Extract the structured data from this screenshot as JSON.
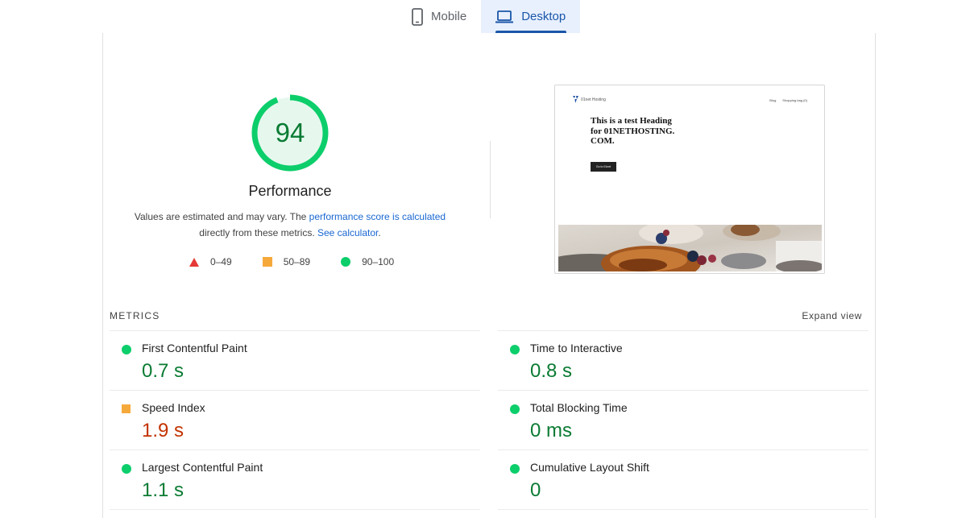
{
  "tabs": [
    {
      "label": "Mobile",
      "icon": "phone-icon",
      "active": false
    },
    {
      "label": "Desktop",
      "icon": "laptop-icon",
      "active": true
    }
  ],
  "performance": {
    "score": "94",
    "score_value": 94,
    "title": "Performance",
    "desc_part1": "Values are estimated and may vary. The ",
    "desc_link1": "performance score is calculated",
    "desc_part2": " directly from these metrics. ",
    "desc_link2": "See calculator",
    "desc_part3": ".",
    "colors": {
      "pass": "#0cce6b",
      "average": "#f6a93b",
      "fail": "#e53935",
      "pass_text": "#0a7b33",
      "average_text": "#c33300"
    }
  },
  "legend": [
    {
      "label": "0–49",
      "shape": "triangle"
    },
    {
      "label": "50–89",
      "shape": "square"
    },
    {
      "label": "90–100",
      "shape": "circle"
    }
  ],
  "screenshot": {
    "logo_text": "01net Hosting",
    "nav": [
      "Blog",
      "Shopping bag (0)"
    ],
    "heading": "This is a test Heading for 01NETHOSTING. COM.",
    "button": "Go to 01net"
  },
  "metrics": {
    "label": "METRICS",
    "expand_label": "Expand view",
    "left": [
      {
        "name": "First Contentful Paint",
        "value": "0.7 s",
        "rating": "pass"
      },
      {
        "name": "Speed Index",
        "value": "1.9 s",
        "rating": "average"
      },
      {
        "name": "Largest Contentful Paint",
        "value": "1.1 s",
        "rating": "pass"
      }
    ],
    "right": [
      {
        "name": "Time to Interactive",
        "value": "0.8 s",
        "rating": "pass"
      },
      {
        "name": "Total Blocking Time",
        "value": "0 ms",
        "rating": "pass"
      },
      {
        "name": "Cumulative Layout Shift",
        "value": "0",
        "rating": "pass"
      }
    ]
  }
}
